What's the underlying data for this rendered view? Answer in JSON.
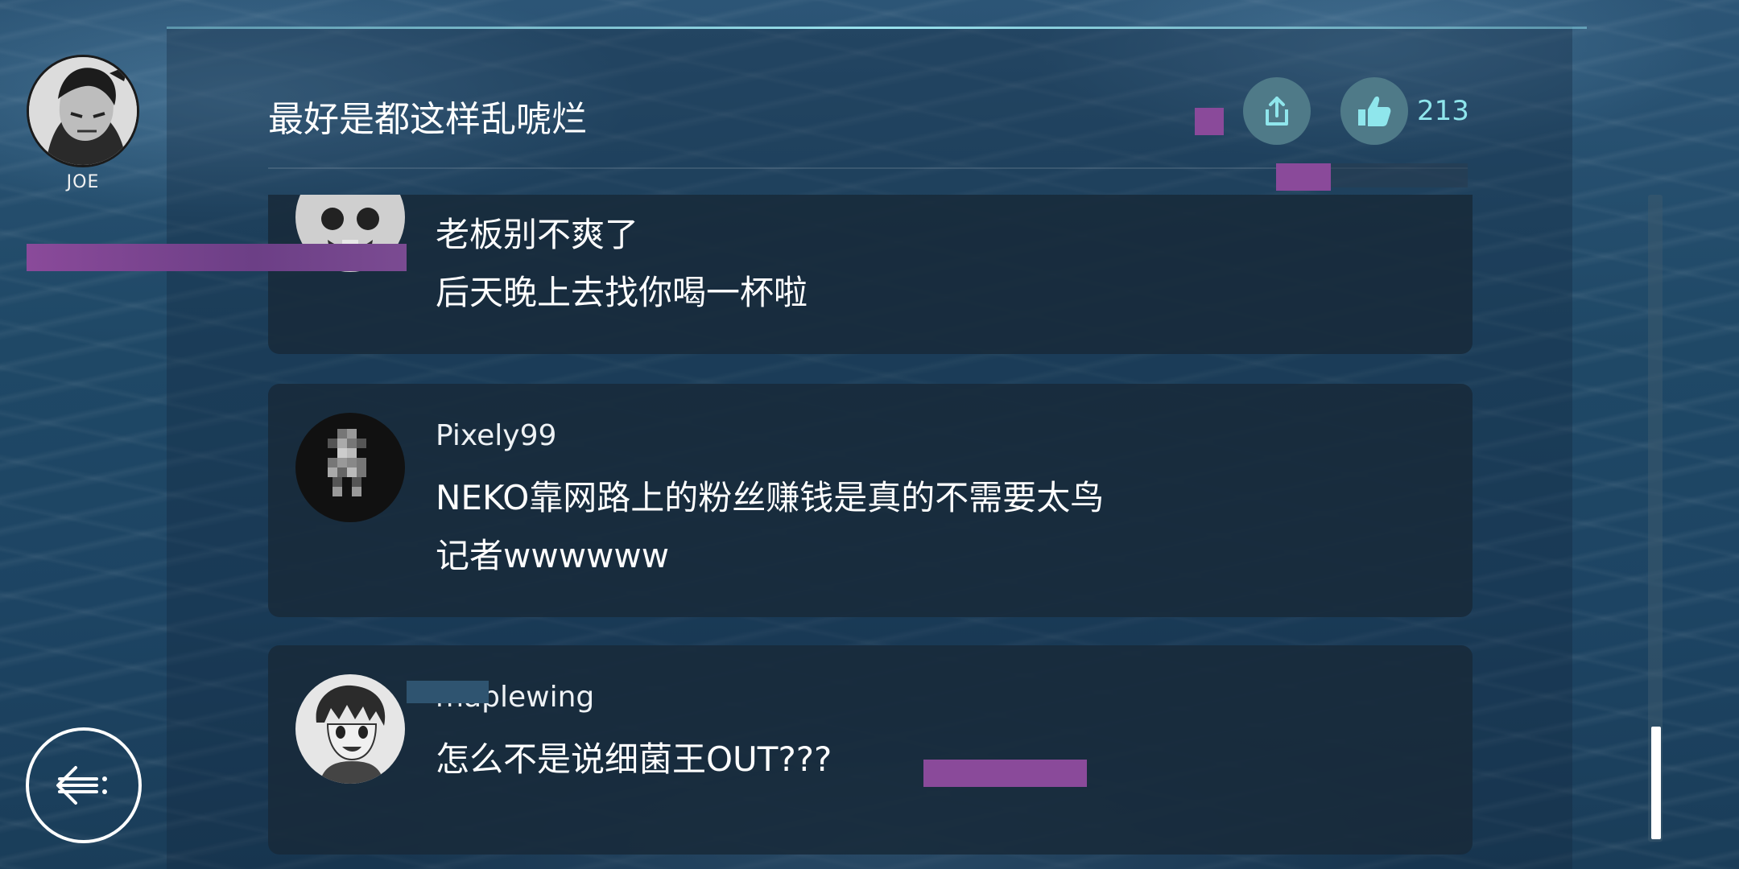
{
  "player": {
    "name": "JOE"
  },
  "post": {
    "title": "最好是都这样乱唬烂",
    "like_count": "213"
  },
  "comments": [
    {
      "user": "",
      "lines": [
        "老板别不爽了",
        "后天晚上去找你喝一杯啦"
      ]
    },
    {
      "user": "Pixely99",
      "lines": [
        "NEKO靠网路上的粉丝赚钱是真的不需要太鸟",
        "记者wwwwww"
      ]
    },
    {
      "user": "maplewing",
      "lines": [
        "怎么不是说细菌王OUT???"
      ]
    }
  ],
  "icons": {
    "share": "share-icon",
    "like": "thumbs-up-icon",
    "back": "back-arrow-icon"
  },
  "colors": {
    "accent": "#8fe6ec",
    "button_bg": "#4f7a88",
    "card_bg": "#182a3a",
    "glitch": "#8a4a9a"
  }
}
